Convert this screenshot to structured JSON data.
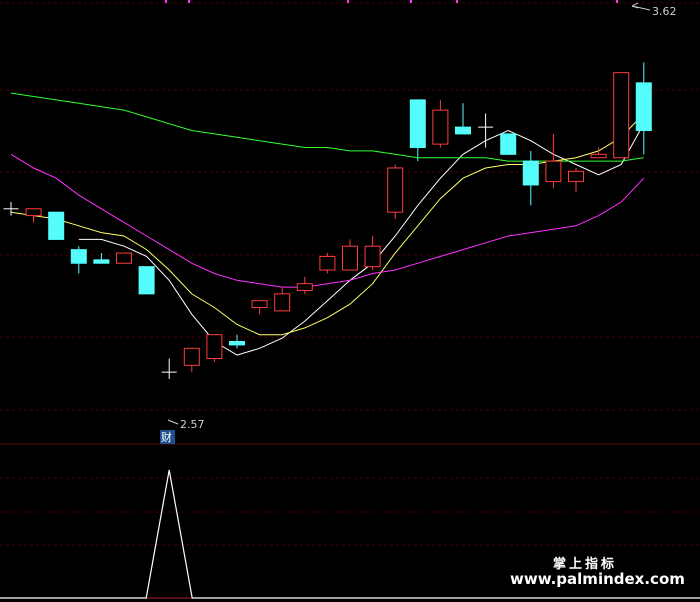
{
  "chart_data": [
    {
      "type": "candlestick",
      "panel": "main",
      "ylim": [
        2.42,
        3.66
      ],
      "candles": [
        {
          "o": 3.07,
          "h": 3.09,
          "l": 3.05,
          "c": 3.07
        },
        {
          "o": 3.05,
          "h": 3.07,
          "l": 3.03,
          "c": 3.07
        },
        {
          "o": 3.06,
          "h": 3.06,
          "l": 2.98,
          "c": 2.98
        },
        {
          "o": 2.95,
          "h": 2.96,
          "l": 2.88,
          "c": 2.91
        },
        {
          "o": 2.92,
          "h": 2.94,
          "l": 2.91,
          "c": 2.91
        },
        {
          "o": 2.91,
          "h": 2.94,
          "l": 2.91,
          "c": 2.94
        },
        {
          "o": 2.9,
          "h": 2.9,
          "l": 2.82,
          "c": 2.82
        },
        {
          "o": 2.59,
          "h": 2.63,
          "l": 2.57,
          "c": 2.59
        },
        {
          "o": 2.61,
          "h": 2.66,
          "l": 2.59,
          "c": 2.66
        },
        {
          "o": 2.63,
          "h": 2.7,
          "l": 2.62,
          "c": 2.7
        },
        {
          "o": 2.68,
          "h": 2.7,
          "l": 2.66,
          "c": 2.67
        },
        {
          "o": 2.78,
          "h": 2.8,
          "l": 2.76,
          "c": 2.8
        },
        {
          "o": 2.77,
          "h": 2.84,
          "l": 2.77,
          "c": 2.82
        },
        {
          "o": 2.83,
          "h": 2.87,
          "l": 2.82,
          "c": 2.85
        },
        {
          "o": 2.89,
          "h": 2.94,
          "l": 2.88,
          "c": 2.93
        },
        {
          "o": 2.89,
          "h": 2.98,
          "l": 2.89,
          "c": 2.96
        },
        {
          "o": 2.9,
          "h": 2.99,
          "l": 2.89,
          "c": 2.96
        },
        {
          "o": 3.06,
          "h": 3.2,
          "l": 3.04,
          "c": 3.19
        },
        {
          "o": 3.39,
          "h": 3.39,
          "l": 3.21,
          "c": 3.25
        },
        {
          "o": 3.26,
          "h": 3.39,
          "l": 3.25,
          "c": 3.36
        },
        {
          "o": 3.31,
          "h": 3.38,
          "l": 3.3,
          "c": 3.29
        },
        {
          "o": 3.31,
          "h": 3.35,
          "l": 3.25,
          "c": 3.31
        },
        {
          "o": 3.29,
          "h": 3.29,
          "l": 3.23,
          "c": 3.23
        },
        {
          "o": 3.21,
          "h": 3.24,
          "l": 3.08,
          "c": 3.14
        },
        {
          "o": 3.15,
          "h": 3.29,
          "l": 3.13,
          "c": 3.21
        },
        {
          "o": 3.15,
          "h": 3.19,
          "l": 3.12,
          "c": 3.18
        },
        {
          "o": 3.22,
          "h": 3.25,
          "l": 3.22,
          "c": 3.23
        },
        {
          "o": 3.22,
          "h": 3.47,
          "l": 3.22,
          "c": 3.47
        },
        {
          "o": 3.44,
          "h": 3.5,
          "l": 3.23,
          "c": 3.3
        }
      ],
      "series": [
        {
          "color": "#ffffff",
          "values": [
            null,
            null,
            null,
            2.98,
            2.98,
            2.96,
            2.93,
            2.86,
            2.76,
            2.68,
            2.64,
            2.66,
            2.69,
            2.74,
            2.8,
            2.86,
            2.91,
            2.99,
            3.08,
            3.16,
            3.23,
            3.27,
            3.3,
            3.27,
            3.23,
            3.2,
            3.17,
            3.2,
            3.32
          ]
        },
        {
          "color": "#ffff66",
          "values": [
            3.06,
            3.05,
            3.04,
            3.02,
            3.0,
            2.99,
            2.95,
            2.89,
            2.82,
            2.78,
            2.73,
            2.7,
            2.7,
            2.72,
            2.75,
            2.79,
            2.85,
            2.94,
            3.02,
            3.1,
            3.16,
            3.19,
            3.2,
            3.2,
            3.21,
            3.22,
            3.24,
            3.28,
            3.35
          ]
        },
        {
          "color": "#ff33ff",
          "values": [
            3.23,
            3.19,
            3.16,
            3.11,
            3.07,
            3.03,
            2.99,
            2.95,
            2.91,
            2.88,
            2.86,
            2.85,
            2.84,
            2.84,
            2.85,
            2.86,
            2.88,
            2.89,
            2.91,
            2.93,
            2.95,
            2.97,
            2.99,
            3.0,
            3.01,
            3.02,
            3.05,
            3.09,
            3.16
          ]
        },
        {
          "color": "#33ff33",
          "values": [
            3.41,
            3.4,
            3.39,
            3.38,
            3.37,
            3.36,
            3.34,
            3.32,
            3.3,
            3.29,
            3.28,
            3.27,
            3.26,
            3.25,
            3.25,
            3.24,
            3.24,
            3.23,
            3.22,
            3.22,
            3.22,
            3.22,
            3.21,
            3.21,
            3.21,
            3.21,
            3.21,
            3.21,
            3.22
          ]
        }
      ],
      "annotations": {
        "high_label": "3.62",
        "low_label": "2.57",
        "tag_label": "财"
      }
    },
    {
      "type": "line",
      "panel": "indicator",
      "ylim": [
        0,
        1
      ],
      "values": [
        0,
        0,
        0,
        0,
        0,
        0,
        0,
        1,
        0,
        0,
        0,
        0,
        0,
        0,
        0,
        0,
        0,
        0,
        0,
        0,
        0,
        0,
        0,
        0,
        0,
        0,
        0,
        0,
        0
      ]
    }
  ],
  "colors": {
    "up": "#ff3c3c",
    "down": "#54fcfc",
    "grid": "#4a0000",
    "background": "#000000"
  },
  "watermark": {
    "line1": "掌上指标",
    "line2": "www.palmindex.com"
  }
}
